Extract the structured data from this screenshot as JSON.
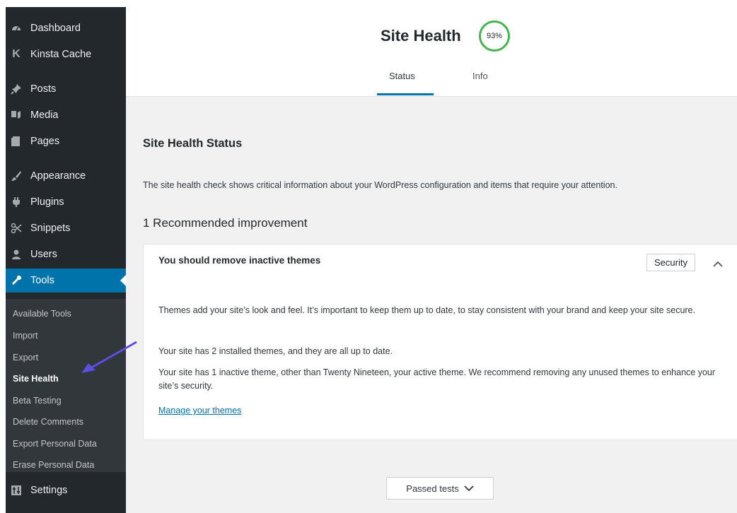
{
  "sidebar": {
    "menu": [
      {
        "label": "Dashboard",
        "icon": "dashboard-icon"
      },
      {
        "label": "Kinsta Cache",
        "icon": "kinsta-icon"
      },
      {
        "label": "Posts",
        "icon": "pin-icon"
      },
      {
        "label": "Media",
        "icon": "media-icon"
      },
      {
        "label": "Pages",
        "icon": "pages-icon"
      },
      {
        "label": "Appearance",
        "icon": "brush-icon"
      },
      {
        "label": "Plugins",
        "icon": "plugin-icon"
      },
      {
        "label": "Snippets",
        "icon": "scissors-icon"
      },
      {
        "label": "Users",
        "icon": "users-icon"
      },
      {
        "label": "Tools",
        "icon": "wrench-icon"
      }
    ],
    "submenu": [
      "Available Tools",
      "Import",
      "Export",
      "Site Health",
      "Beta Testing",
      "Delete Comments",
      "Export Personal Data",
      "Erase Personal Data"
    ],
    "settings": {
      "label": "Settings",
      "icon": "settings-icon"
    }
  },
  "header": {
    "title": "Site Health",
    "score": "93%",
    "tabs": [
      "Status",
      "Info"
    ]
  },
  "main": {
    "heading": "Site Health Status",
    "description": "The site health check shows critical information about your WordPress configuration and items that require your attention.",
    "recommendation_count": "1 Recommended improvement",
    "card": {
      "title": "You should remove inactive themes",
      "badge": "Security",
      "paragraphs": [
        "Themes add your site’s look and feel. It’s important to keep them up to date, to stay consistent with your brand and keep your site secure.",
        "Your site has 2 installed themes, and they are all up to date.",
        "Your site has 1 inactive theme, other than Twenty Nineteen, your active theme. We recommend removing any unused themes to enhance your site’s security."
      ],
      "link": "Manage your themes"
    },
    "passed_tests": "Passed tests"
  },
  "colors": {
    "sidebar_bg": "#23282d",
    "submenu_bg": "#32373c",
    "accent": "#0073aa",
    "score_ring": "#46b450",
    "annotation_arrow": "#5b4fe0"
  }
}
